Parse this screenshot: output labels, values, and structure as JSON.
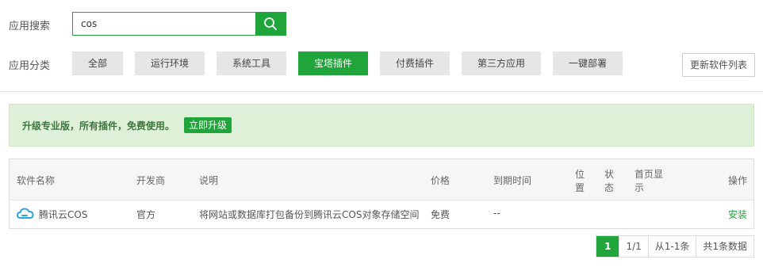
{
  "search": {
    "label": "应用搜索",
    "value": "cos"
  },
  "categories": {
    "label": "应用分类",
    "items": [
      "全部",
      "运行环境",
      "系统工具",
      "宝塔插件",
      "付费插件",
      "第三方应用",
      "一键部署"
    ],
    "active": "宝塔插件"
  },
  "update_button": "更新软件列表",
  "notice": {
    "text": "升级专业版，所有插件，免费使用。",
    "button": "立即升级"
  },
  "table": {
    "headers": {
      "name": "软件名称",
      "developer": "开发商",
      "description": "说明",
      "price": "价格",
      "expire": "到期时间",
      "position_1": "位",
      "position_2": "置",
      "status_1": "状",
      "status_2": "态",
      "homepage_1": "首页显",
      "homepage_2": "示",
      "action": "操作"
    },
    "rows": [
      {
        "name": "腾讯云COS",
        "developer": "官方",
        "description": "将网站或数据库打包备份到腾讯云COS对象存储空间",
        "price": "免费",
        "expire": "--",
        "action": "安装"
      }
    ]
  },
  "pagination": {
    "current": "1",
    "pages": "1/1",
    "range": "从1-1条",
    "total": "共1条数据"
  },
  "colors": {
    "accent": "#20a53a",
    "notice_bg": "#dff0d8"
  }
}
